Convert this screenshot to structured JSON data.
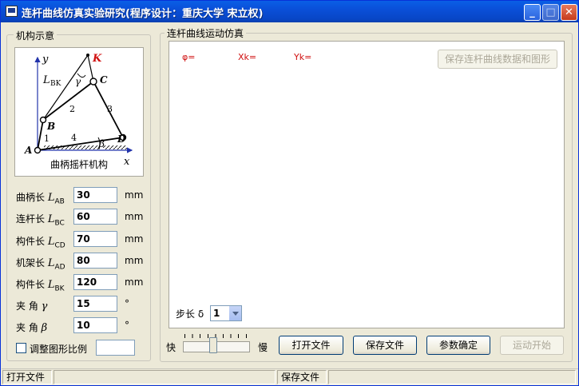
{
  "window": {
    "title": "连杆曲线仿真实验研究(程序设计：重庆大学  宋立权)",
    "minimize_icon": "minimize-icon",
    "maximize_icon": "maximize-icon",
    "close_icon": "close-icon"
  },
  "mechanism": {
    "group_title": "机构示意",
    "diagram_caption": "曲柄摇杆机构",
    "points": {
      "A": "A",
      "B": "B",
      "C": "C",
      "D": "D",
      "K": "K"
    },
    "axis_x": "x",
    "axis_y": "y",
    "link_numbers": [
      "1",
      "2",
      "3",
      "4"
    ],
    "lbk_label": "L",
    "lbk_sub": "BK",
    "gamma": "γ",
    "beta": "β"
  },
  "params": [
    {
      "label": "曲柄长 ",
      "sym": "L",
      "sub": "AB",
      "value": "30",
      "unit": "mm"
    },
    {
      "label": "连杆长 ",
      "sym": "L",
      "sub": "BC",
      "value": "60",
      "unit": "mm"
    },
    {
      "label": "构件长 ",
      "sym": "L",
      "sub": "CD",
      "value": "70",
      "unit": "mm"
    },
    {
      "label": "机架长 ",
      "sym": "L",
      "sub": "AD",
      "value": "80",
      "unit": "mm"
    },
    {
      "label": "构件长 ",
      "sym": "L",
      "sub": "BK",
      "value": "120",
      "unit": "mm"
    },
    {
      "label": "夹  角 ",
      "sym": "γ",
      "sub": "",
      "value": "15",
      "unit": "°"
    },
    {
      "label": "夹  角 ",
      "sym": "β",
      "sub": "",
      "value": "10",
      "unit": "°"
    }
  ],
  "scale_checkbox": {
    "label": "调整图形比例",
    "checked": false,
    "value": ""
  },
  "simulation": {
    "group_title": "连杆曲线运动仿真",
    "phi_label": "φ=",
    "xk_label": "Xk=",
    "yk_label": "Yk=",
    "save_data_button": "保存连杆曲线数据和图形",
    "step_label": "步长 δ",
    "step_value": "1",
    "speed_fast": "快",
    "speed_slow": "慢",
    "speed_level_fraction": 0.45,
    "open_file_button": "打开文件",
    "save_file_button": "保存文件",
    "confirm_button": "参数确定",
    "start_button": "运动开始"
  },
  "status": [
    "打开文件",
    "",
    "",
    "保存文件",
    ""
  ],
  "colors": {
    "title_bar": "#0a4fd8",
    "readout": "#d01010",
    "point_K": "#d01010",
    "axis": "#2233aa"
  }
}
